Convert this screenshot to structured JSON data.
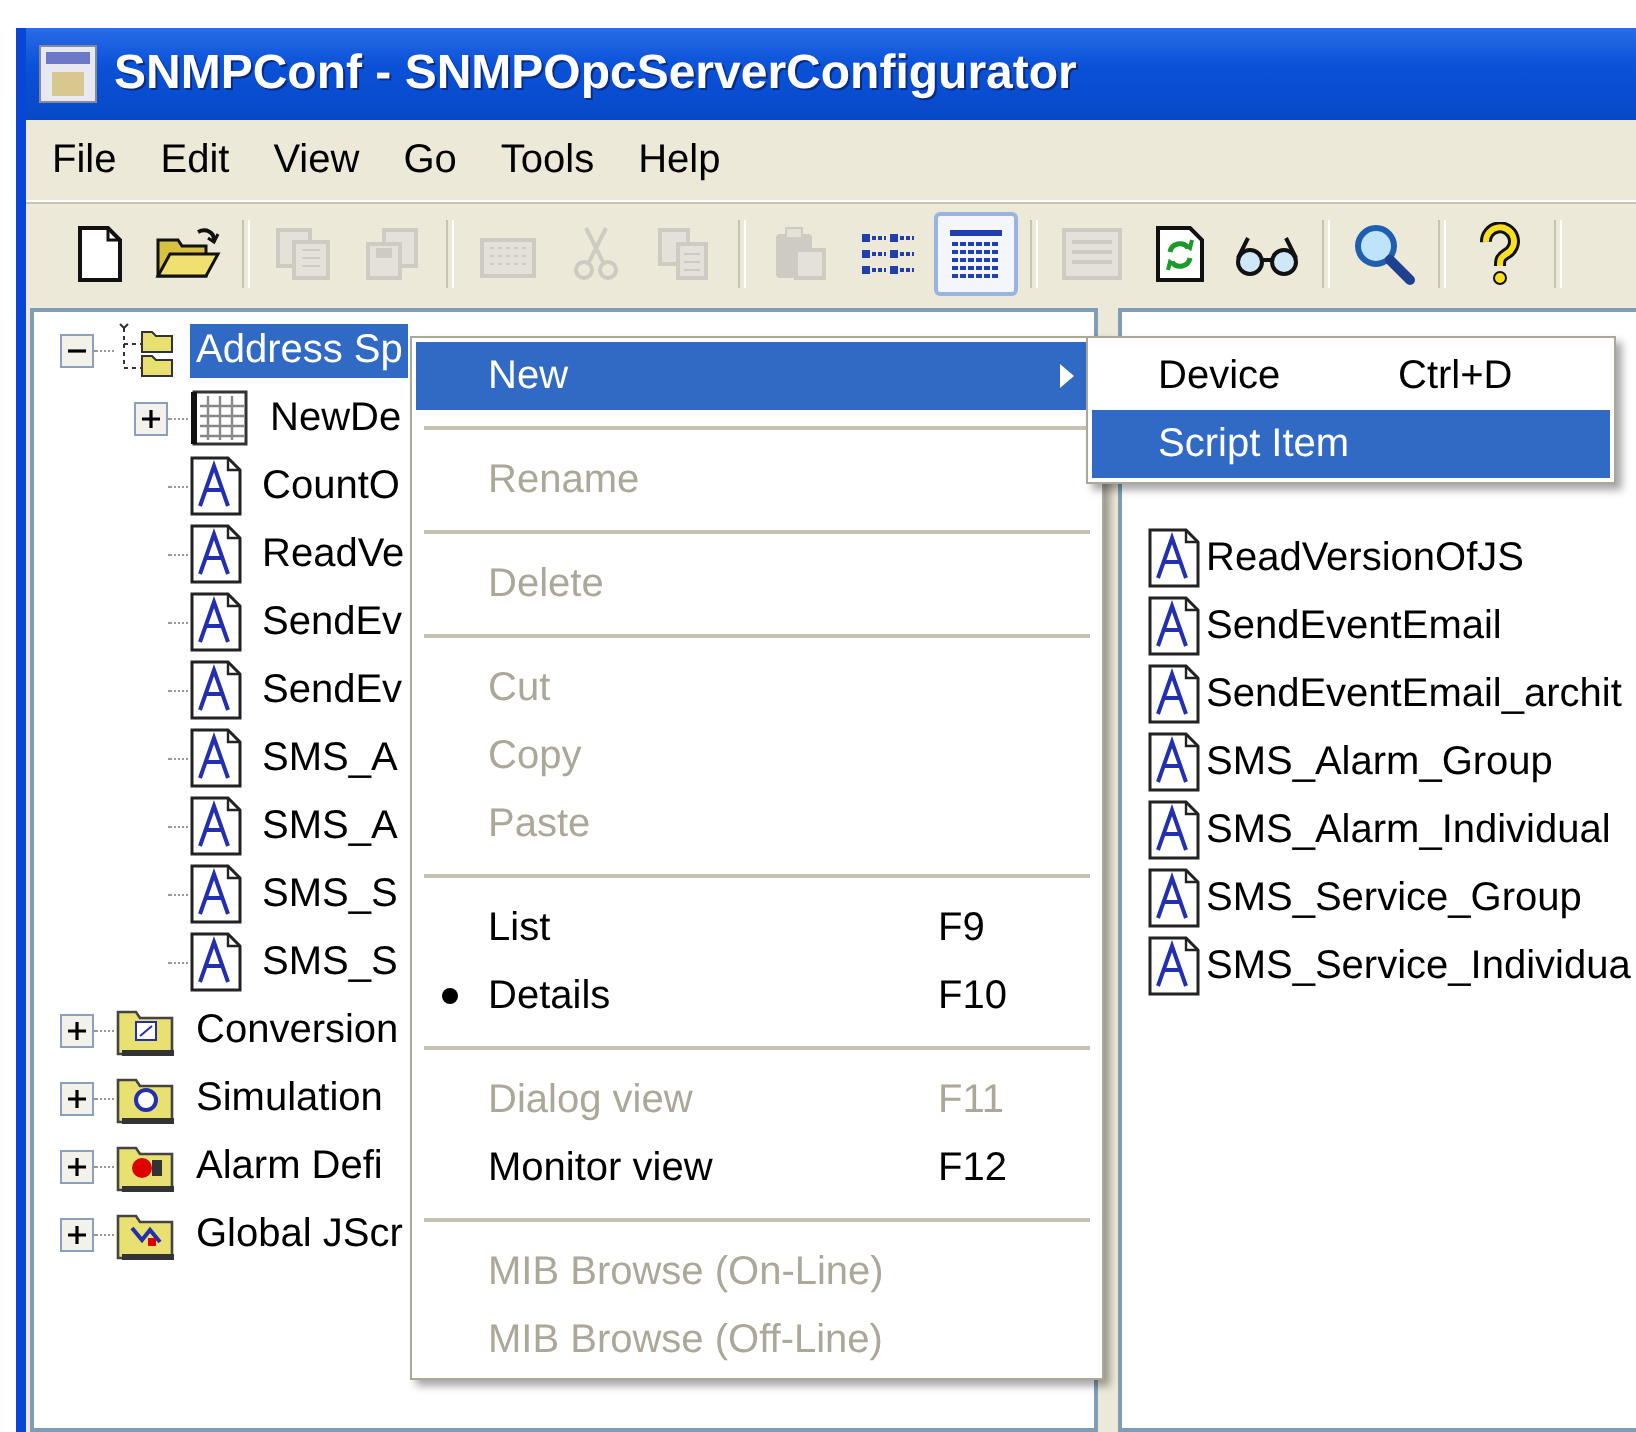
{
  "window": {
    "title": "SNMPConf - SNMPOpcServerConfigurator"
  },
  "menu_bar": [
    "File",
    "Edit",
    "View",
    "Go",
    "Tools",
    "Help"
  ],
  "toolbar": [
    {
      "kind": "new",
      "disabled": false,
      "pressed": false
    },
    {
      "kind": "open",
      "disabled": false,
      "pressed": false
    },
    {
      "kind": "separator"
    },
    {
      "kind": "save_all",
      "disabled": true,
      "pressed": false
    },
    {
      "kind": "save",
      "disabled": true,
      "pressed": false
    },
    {
      "kind": "separator"
    },
    {
      "kind": "device",
      "disabled": true,
      "pressed": false
    },
    {
      "kind": "cut",
      "disabled": true,
      "pressed": false
    },
    {
      "kind": "copy",
      "disabled": true,
      "pressed": false
    },
    {
      "kind": "separator"
    },
    {
      "kind": "paste",
      "disabled": true,
      "pressed": false
    },
    {
      "kind": "list_view",
      "disabled": false,
      "pressed": false
    },
    {
      "kind": "details_view",
      "disabled": false,
      "pressed": true
    },
    {
      "kind": "separator"
    },
    {
      "kind": "dialog_view",
      "disabled": true,
      "pressed": false
    },
    {
      "kind": "refresh",
      "disabled": false,
      "pressed": false
    },
    {
      "kind": "monitor",
      "disabled": false,
      "pressed": false
    },
    {
      "kind": "separator"
    },
    {
      "kind": "search",
      "disabled": false,
      "pressed": false
    },
    {
      "kind": "separator"
    },
    {
      "kind": "help",
      "disabled": false,
      "pressed": false
    },
    {
      "kind": "separator"
    }
  ],
  "tree": [
    {
      "label": "Address Sp",
      "kind": "address_space",
      "expanded": true,
      "selected": true,
      "children": [
        {
          "label": "NewDe",
          "kind": "device",
          "expanded": false,
          "selected": false
        },
        {
          "label": "CountO",
          "kind": "script",
          "selected": false
        },
        {
          "label": "ReadVe",
          "kind": "script",
          "selected": false
        },
        {
          "label": "SendEv",
          "kind": "script",
          "selected": false
        },
        {
          "label": "SendEv",
          "kind": "script",
          "selected": false
        },
        {
          "label": "SMS_A",
          "kind": "script",
          "selected": false
        },
        {
          "label": "SMS_A",
          "kind": "script",
          "selected": false
        },
        {
          "label": "SMS_S",
          "kind": "script",
          "selected": false
        },
        {
          "label": "SMS_S",
          "kind": "script",
          "selected": false
        }
      ]
    },
    {
      "label": "Conversion",
      "kind": "conversion",
      "expanded": false,
      "selected": false
    },
    {
      "label": "Simulation",
      "kind": "simulation",
      "expanded": false,
      "selected": false
    },
    {
      "label": "Alarm Defi",
      "kind": "alarm",
      "expanded": false,
      "selected": false
    },
    {
      "label": "Global JScr",
      "kind": "global_script",
      "expanded": false,
      "selected": false
    }
  ],
  "list": [
    "ReadVersionOfJS",
    "SendEventEmail",
    "SendEventEmail_archit",
    "SMS_Alarm_Group",
    "SMS_Alarm_Individual",
    "SMS_Service_Group",
    "SMS_Service_Individua"
  ],
  "context_menu": [
    {
      "kind": "item",
      "label": "New",
      "disabled": false,
      "selected": true,
      "checked": false,
      "submenu": true
    },
    {
      "kind": "separator"
    },
    {
      "kind": "item",
      "label": "Rename",
      "disabled": true,
      "selected": false,
      "checked": false,
      "submenu": false
    },
    {
      "kind": "separator"
    },
    {
      "kind": "item",
      "label": "Delete",
      "disabled": true,
      "selected": false,
      "checked": false,
      "submenu": false
    },
    {
      "kind": "separator"
    },
    {
      "kind": "item",
      "label": "Cut",
      "disabled": true,
      "selected": false,
      "checked": false,
      "submenu": false
    },
    {
      "kind": "item",
      "label": "Copy",
      "disabled": true,
      "selected": false,
      "checked": false,
      "submenu": false
    },
    {
      "kind": "item",
      "label": "Paste",
      "disabled": true,
      "selected": false,
      "checked": false,
      "submenu": false
    },
    {
      "kind": "separator"
    },
    {
      "kind": "item",
      "label": "List",
      "shortcut": "F9",
      "disabled": false,
      "selected": false,
      "checked": false,
      "submenu": false
    },
    {
      "kind": "item",
      "label": "Details",
      "shortcut": "F10",
      "disabled": false,
      "selected": false,
      "checked": true,
      "submenu": false
    },
    {
      "kind": "separator"
    },
    {
      "kind": "item",
      "label": "Dialog view",
      "shortcut": "F11",
      "disabled": true,
      "selected": false,
      "checked": false,
      "submenu": false
    },
    {
      "kind": "item",
      "label": "Monitor view",
      "shortcut": "F12",
      "disabled": false,
      "selected": false,
      "checked": false,
      "submenu": false
    },
    {
      "kind": "separator"
    },
    {
      "kind": "item",
      "label": "MIB Browse (On-Line)",
      "disabled": true,
      "selected": false,
      "checked": false,
      "submenu": false
    },
    {
      "kind": "item",
      "label": "MIB Browse (Off-Line)",
      "disabled": true,
      "selected": false,
      "checked": false,
      "submenu": false
    }
  ],
  "submenu": [
    {
      "label": "Device",
      "shortcut": "Ctrl+D",
      "selected": false
    },
    {
      "label": "Script Item",
      "selected": true
    }
  ]
}
